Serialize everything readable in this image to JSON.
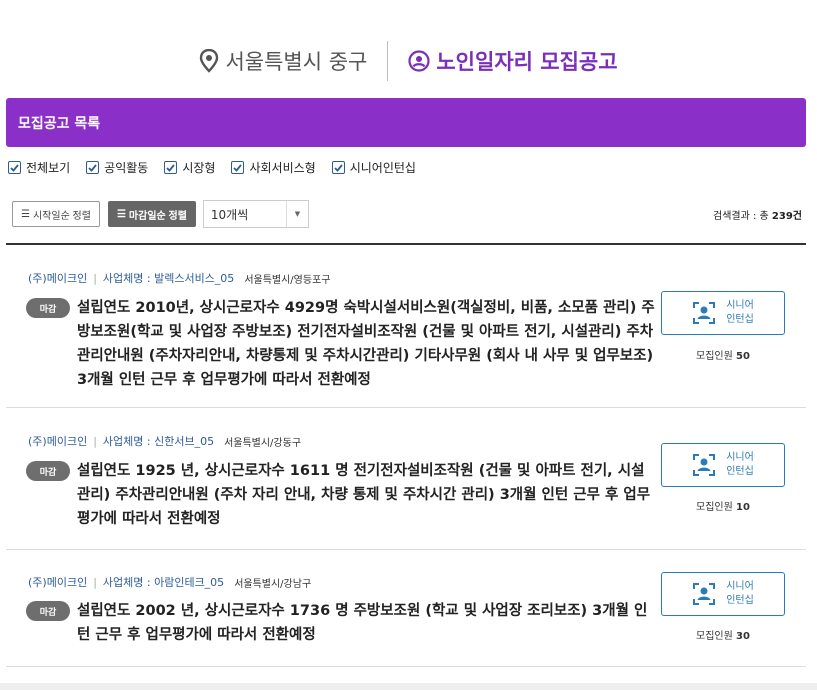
{
  "header": {
    "location": "서울특별시 중구",
    "title": "노인일자리 모집공고"
  },
  "list_title": "모집공고 목록",
  "filters": [
    "전체보기",
    "공익활동",
    "시장형",
    "사회서비스형",
    "시니어인턴십"
  ],
  "controls": {
    "sort_start": "시작일순 정렬",
    "sort_end": "마감일순 정렬",
    "page_size": "10개씩",
    "result_label": "검색결과 : 총",
    "result_count": "239건"
  },
  "items": [
    {
      "company": "(주)메이크인",
      "business": "사업체명 : 발렉스서비스_05",
      "region": "서울특별시/영등포구",
      "badge": "마감",
      "description": "설립연도 2010년, 상시근로자수 4929명 숙박시설서비스원(객실정비, 비품, 소모품 관리) 주방보조원(학교 및 사업장 주방보조) 전기전자설비조작원 (건물 및 아파트 전기, 시설관리) 주차관리안내원 (주차자리안내, 차량통제 및 주차시간관리) 기타사무원 (회사 내 사무 및 업무보조) 3개월 인턴 근무 후 업무평가에 따라서 전환예정",
      "type_line1": "시니어",
      "type_line2": "인턴십",
      "recruit_label": "모집인원",
      "recruit_count": "50"
    },
    {
      "company": "(주)메이크인",
      "business": "사업체명 : 신한서브_05",
      "region": "서울특별시/강동구",
      "badge": "마감",
      "description": "설립연도 1925 년, 상시근로자수 1611 명 전기전자설비조작원 (건물 및 아파트 전기, 시설관리) 주차관리안내원 (주차 자리 안내, 차량 통제 및 주차시간 관리) 3개월 인턴 근무 후 업무평가에 따라서 전환예정",
      "type_line1": "시니어",
      "type_line2": "인턴십",
      "recruit_label": "모집인원",
      "recruit_count": "10"
    },
    {
      "company": "(주)메이크인",
      "business": "사업체명 : 아람인테크_05",
      "region": "서울특별시/강남구",
      "badge": "마감",
      "description": "설립연도 2002 년, 상시근로자수 1736 명 주방보조원 (학교 및 사업장 조리보조) 3개월 인턴 근무 후 업무평가에 따라서 전환예정",
      "type_line1": "시니어",
      "type_line2": "인턴십",
      "recruit_label": "모집인원",
      "recruit_count": "30"
    }
  ],
  "colors": {
    "accent": "#8b2fc9",
    "title": "#7a2fb8",
    "link": "#2d5b9a",
    "senior": "#2a7bb8"
  }
}
